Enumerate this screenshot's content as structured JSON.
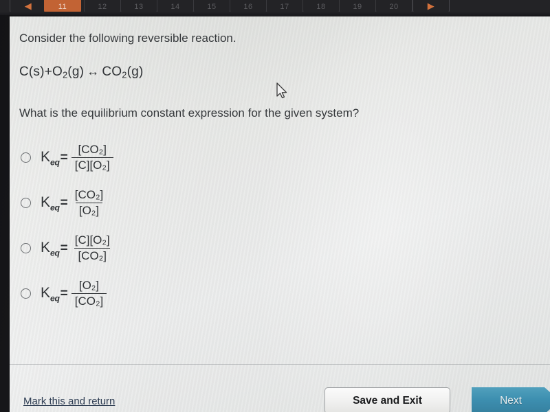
{
  "browser_tabs": {
    "numbers": [
      "11",
      "12",
      "13",
      "14",
      "15",
      "16",
      "17",
      "18",
      "19",
      "20"
    ],
    "active_number": "11",
    "back_arrow": "◀",
    "forward_arrow": "▶",
    "active_color": "#c26334"
  },
  "question": {
    "prompt": "Consider the following reversible reaction.",
    "equation": {
      "reactant_1": "C(s)",
      "plus": "+",
      "reactant_2_base": "O",
      "reactant_2_sub": "2",
      "reactant_2_state": "(g)",
      "arrow": "↔",
      "product_base": "CO",
      "product_sub": "2",
      "product_state": "(g)"
    },
    "text": "What is the equilibrium constant expression for the given system?"
  },
  "options": [
    {
      "id": "option-a",
      "label": "K",
      "label_sub": "eq",
      "equals": "=",
      "numerator": "[CO₂]",
      "denominator": "[C][O₂]",
      "selected": false
    },
    {
      "id": "option-b",
      "label": "K",
      "label_sub": "eq",
      "equals": "=",
      "numerator": "[CO₂]",
      "denominator": "[O₂]",
      "selected": false
    },
    {
      "id": "option-c",
      "label": "K",
      "label_sub": "eq",
      "equals": "=",
      "numerator": "[C][O₂]",
      "denominator": "[CO₂]",
      "selected": false
    },
    {
      "id": "option-d",
      "label": "K",
      "label_sub": "eq",
      "equals": "=",
      "numerator": "[O₂]",
      "denominator": "[CO₂]",
      "selected": false
    }
  ],
  "footer": {
    "mark_link": "Mark this and return",
    "save_exit_label": "Save and Exit",
    "next_label": "Next",
    "next_color": "#3d8fb0",
    "link_color": "#2d3c52"
  }
}
